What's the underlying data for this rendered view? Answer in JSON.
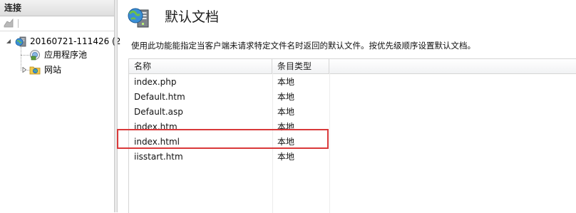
{
  "connections": {
    "header": "连接",
    "tree": {
      "server": "20160721-111426 (2",
      "app_pools": "应用程序池",
      "sites": "网站"
    }
  },
  "page": {
    "title": "默认文档",
    "description": "使用此功能能指定当客户端未请求特定文件名时返回的默认文件。按优先级顺序设置默认文档。"
  },
  "list": {
    "columns": [
      "名称",
      "条目类型"
    ],
    "rows": [
      {
        "name": "index.php",
        "type": "本地"
      },
      {
        "name": "Default.htm",
        "type": "本地"
      },
      {
        "name": "Default.asp",
        "type": "本地"
      },
      {
        "name": "index.htm",
        "type": "本地"
      },
      {
        "name": "index.html",
        "type": "本地"
      },
      {
        "name": "iisstart.htm",
        "type": "本地"
      }
    ]
  },
  "highlighted_row": "index.html",
  "colors": {
    "highlight_border": "#d9393a",
    "header_bg": "#dedede"
  }
}
